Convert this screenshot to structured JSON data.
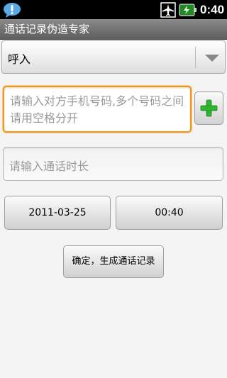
{
  "status_bar": {
    "time": "0:40",
    "icons": [
      "message-bubble-icon",
      "airplane-mode-icon",
      "battery-charging-icon"
    ]
  },
  "title_bar": {
    "title": "通话记录伪造专家"
  },
  "call_type": {
    "selected": "呼入",
    "icon": "chevron-down-icon"
  },
  "phone_input": {
    "placeholder": "请输入对方手机号码,多个号码之间请用空格分开",
    "value": ""
  },
  "add_contact": {
    "icon": "plus-icon",
    "color": "#2fb52f"
  },
  "duration_input": {
    "placeholder": "请输入通话时长",
    "value": ""
  },
  "date_button": {
    "label": "2011-03-25"
  },
  "time_button": {
    "label": "00:40"
  },
  "confirm_button": {
    "label": "确定，生成通话记录"
  },
  "colors": {
    "focus_border": "#f2971d",
    "title_bar": "#6e6e6e",
    "background": "#f4f4f4"
  }
}
